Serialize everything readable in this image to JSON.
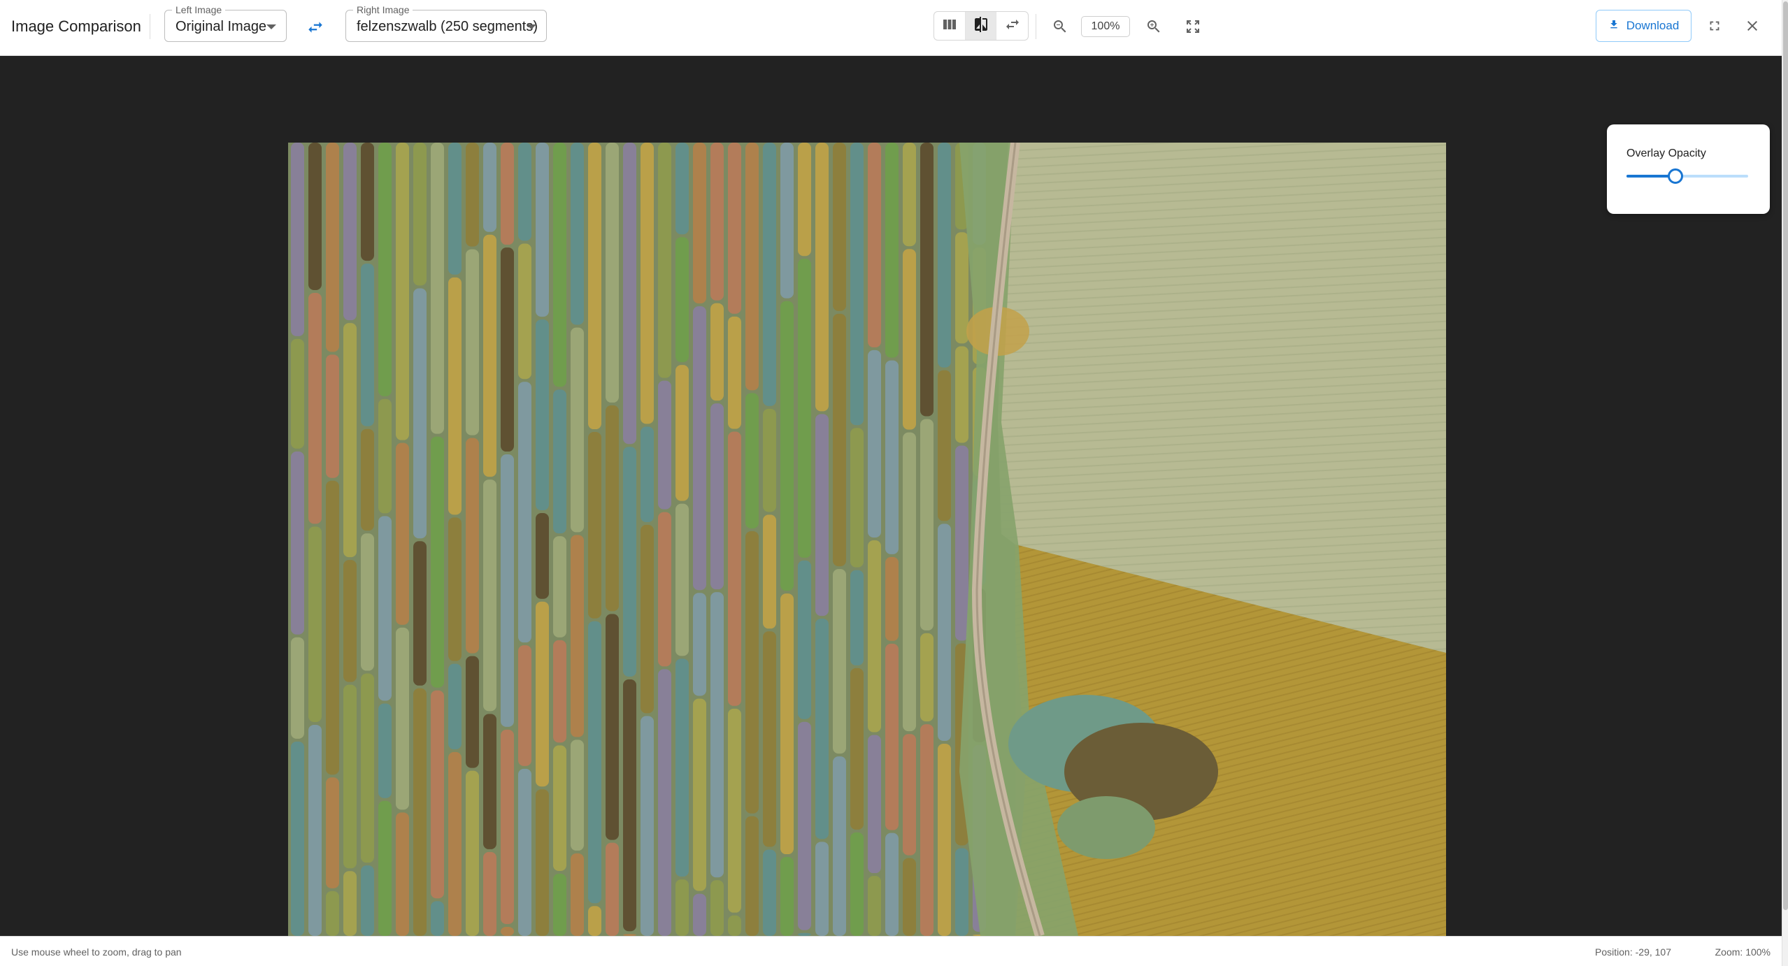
{
  "app": {
    "title": "Image Comparison"
  },
  "left_select": {
    "legend": "Left Image",
    "value": "Original Image"
  },
  "right_select": {
    "legend": "Right Image",
    "value": "felzenszwalb (250 segments)"
  },
  "toolbar": {
    "swap_icon": "swap-horizontal-icon",
    "view_modes": [
      {
        "name": "side-by-side",
        "icon": "columns-icon",
        "active": false
      },
      {
        "name": "overlay",
        "icon": "compare-icon",
        "active": true
      },
      {
        "name": "slider",
        "icon": "swap-arrows-icon",
        "active": false
      }
    ],
    "zoom_level": "100%",
    "download_label": "Download"
  },
  "overlay_panel": {
    "label": "Overlay Opacity",
    "opacity": 0.4
  },
  "status": {
    "hint": "Use mouse wheel to zoom, drag to pan",
    "position": "Position: -29, 107",
    "zoom": "Zoom: 100%"
  },
  "colors": {
    "accent": "#1976d2",
    "viewer_background": "#222222",
    "segment_palette": [
      "#b97a5a",
      "#7f9aa6",
      "#8f9a4e",
      "#a9a44f",
      "#5f8f8f",
      "#b47f4a",
      "#8a7e9e",
      "#6f9e4b",
      "#c1a247",
      "#5c4a2e",
      "#9fa979",
      "#8f7d3a"
    ]
  }
}
